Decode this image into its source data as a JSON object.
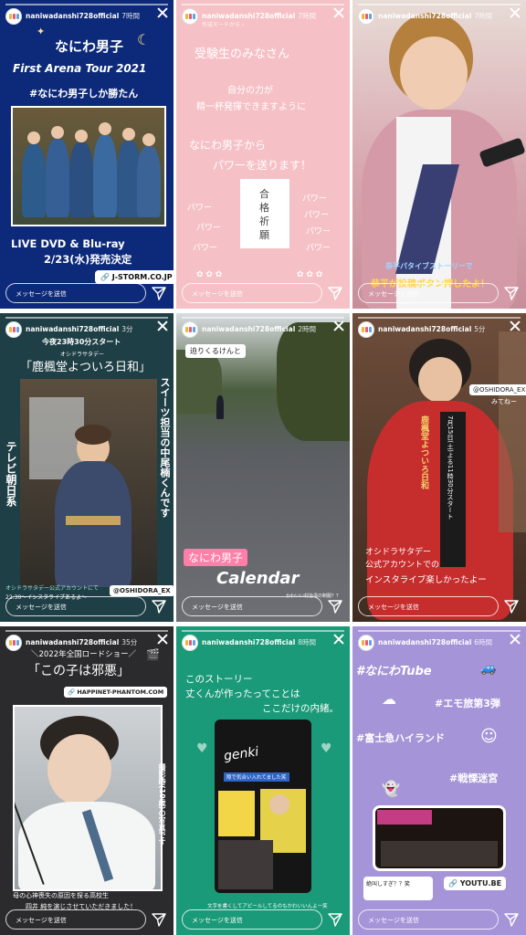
{
  "username": "naniwadanshi728official",
  "message_placeholder": "メッセージを送信",
  "stories": [
    {
      "time": "7時間",
      "lines": [
        "なにわ男子",
        "First Arena Tour 2021",
        "#なにわ男子しか勝たん",
        "LIVE DVD & Blu-ray",
        "2/23(水)発売決定"
      ],
      "link": "J-STORM.CO.JP"
    },
    {
      "time": "7時間",
      "subtitle": "作成モードから ›",
      "lines": [
        "受験生のみなさん",
        "自分の力が",
        "精一杯発揮できますように",
        "なにわ男子から",
        "パワーを送ります！",
        "合",
        "格",
        "祈",
        "願",
        "パワー",
        "パワー",
        "パワー",
        "パワー",
        "パワー",
        "パワー",
        "パワー"
      ]
    },
    {
      "time": "7時間",
      "lines": [
        "恭平パタイブストーリーで",
        "恭平が投稿ボタン押したよ！"
      ]
    },
    {
      "time": "3分",
      "lines": [
        "今夜23時30分スタート",
        "オシドラサタデー",
        "「鹿楓堂よついろ日和」",
        "スイーツ担当の中尾楠くんです",
        "テレビ朝日系",
        "オシドラサタデー公式アカウントにて",
        "22:30～インスタライブあるよ～",
        "@OSHIDORA_EX"
      ]
    },
    {
      "time": "2時間",
      "lines": [
        "迫りくるけんと",
        "なにわ男子",
        "Calendar",
        "かわいい村治凛の制服？？"
      ]
    },
    {
      "time": "5分",
      "lines": [
        "@OSHIDORA_EX",
        "みてねー",
        "オシドラサタデー",
        "公式アカウントでの",
        "インスタライブ楽しかったよー",
        "鹿楓堂よついろ日和",
        "7月15日(土)よる11時30分スタート"
      ]
    },
    {
      "time": "35分",
      "lines": [
        "＼2022年全国ロードショー／",
        "「この子は邪悪」",
        "HAPPINET-PHANTOM.COM",
        "撮影時(19歳)の写真です",
        "母の心神喪失の原因を探る高校生",
        "四井 純を演じさせていただきました！"
      ]
    },
    {
      "time": "8時間",
      "lines": [
        "このストーリー",
        "丈くんが作ったってことは",
        "ここだけの内緒。",
        "genki",
        "隙で気合い入れてました笑",
        "文字を書くしてアピールしてるのもかわいいんよー笑"
      ]
    },
    {
      "time": "6時間",
      "lines": [
        "#なにわTube",
        "#エモ旅第3弾",
        "#富士急ハイランド",
        "#戦慄迷宮",
        "絶叫しすぎ？？笑"
      ],
      "link": "YOUTU.BE"
    }
  ]
}
